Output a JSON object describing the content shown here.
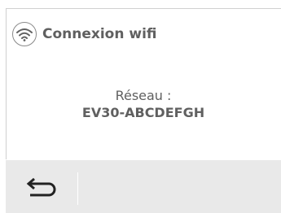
{
  "header": {
    "title": "Connexion wifi",
    "icon": "wifi-icon"
  },
  "content": {
    "label": "Réseau :",
    "network_name": "EV30-ABCDEFGH"
  },
  "footer": {
    "back_icon": "back-arrow-icon"
  },
  "colors": {
    "text": "#606060",
    "footer_background": "#e9e9e9",
    "border": "#d0d0d0"
  }
}
